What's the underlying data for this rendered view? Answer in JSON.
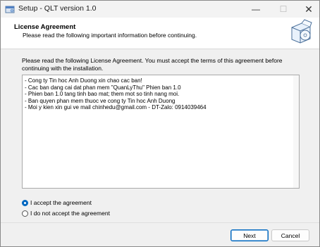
{
  "window": {
    "title": "Setup - QLT version 1.0",
    "controls": {
      "minimize": "—",
      "maximize": "☐",
      "close": "✕"
    }
  },
  "header": {
    "title": "License Agreement",
    "subtitle": "Please read the following important information before continuing.",
    "icon": "setup-box-disc-icon"
  },
  "intro": "Please read the following License Agreement. You must accept the terms of this agreement before continuing with the installation.",
  "license_text": [
    "- Cong ty Tin hoc Anh Duong xin chao cac ban!",
    "- Cac ban dang cai dat phan mem \"QuanLyThu\" Phien ban 1.0",
    "- Phien ban 1.0 tang tinh bao mat; them mot so tinh nang moi.",
    "- Ban quyen phan mem thuoc ve cong ty Tin hoc Anh Duong",
    "- Moi y kien xin gui ve mail chinhedu@gmail.com - DT-Zalo: 0914039464"
  ],
  "options": {
    "accept": {
      "label": "I accept the agreement",
      "checked": true
    },
    "decline": {
      "label": "I do not accept the agreement",
      "checked": false
    }
  },
  "buttons": {
    "next": "Next",
    "cancel": "Cancel"
  },
  "colors": {
    "accent": "#0067c0",
    "titlebar": "#f3f3f3",
    "panel": "#f0f0f0"
  }
}
